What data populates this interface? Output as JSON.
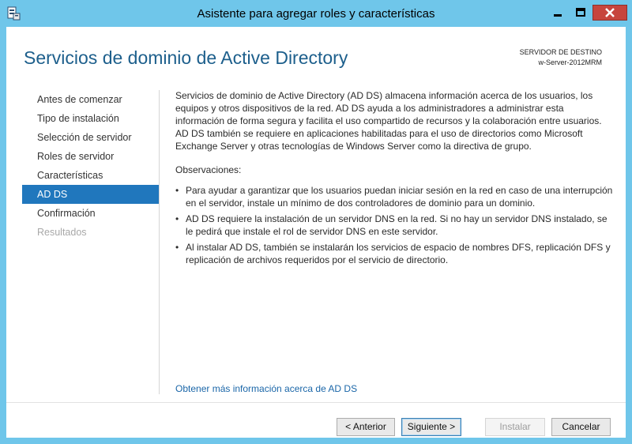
{
  "window": {
    "title": "Asistente para agregar roles y características"
  },
  "header": {
    "title": "Servicios de dominio de Active Directory",
    "destination_label": "SERVIDOR DE DESTINO",
    "destination_server": "w-Server-2012MRM"
  },
  "nav": {
    "items": [
      {
        "label": "Antes de comenzar",
        "state": "normal"
      },
      {
        "label": "Tipo de instalación",
        "state": "normal"
      },
      {
        "label": "Selección de servidor",
        "state": "normal"
      },
      {
        "label": "Roles de servidor",
        "state": "normal"
      },
      {
        "label": "Características",
        "state": "normal"
      },
      {
        "label": "AD DS",
        "state": "active"
      },
      {
        "label": "Confirmación",
        "state": "normal"
      },
      {
        "label": "Resultados",
        "state": "disabled"
      }
    ]
  },
  "content": {
    "intro": "Servicios de dominio de Active Directory (AD DS) almacena información acerca de los usuarios, los equipos y otros dispositivos de la red. AD DS ayuda a los administradores a administrar esta información de forma segura y facilita el uso compartido de recursos y la colaboración entre usuarios. AD DS también se requiere en aplicaciones habilitadas para el uso de directorios como Microsoft Exchange Server y otras tecnologías de Windows Server como la directiva de grupo.",
    "observations_title": "Observaciones:",
    "bullet_glyph": "•",
    "bullets": [
      "Para ayudar a garantizar que los usuarios puedan iniciar sesión en la red en caso de una interrupción en el servidor, instale un mínimo de dos controladores de dominio para un dominio.",
      "AD DS requiere la instalación de un servidor DNS en la red. Si no hay un servidor DNS instalado, se le pedirá que instale el rol de servidor DNS en este servidor.",
      "Al instalar AD DS, también se instalarán los servicios de espacio de nombres DFS, replicación DFS y replicación de archivos requeridos por el servicio de directorio."
    ],
    "more_info_link": "Obtener más información acerca de AD DS"
  },
  "buttons": {
    "previous": "< Anterior",
    "next": "Siguiente >",
    "install": "Instalar",
    "cancel": "Cancelar"
  },
  "icons": {
    "app": "server-manager-icon",
    "minimize": "minimize-icon",
    "maximize": "maximize-icon",
    "close": "close-icon"
  },
  "colors": {
    "frame": "#6fc6ea",
    "title_blue": "#1d5f8c",
    "nav_active": "#2077bd",
    "link": "#1a66a8",
    "close_button": "#c7453d"
  }
}
